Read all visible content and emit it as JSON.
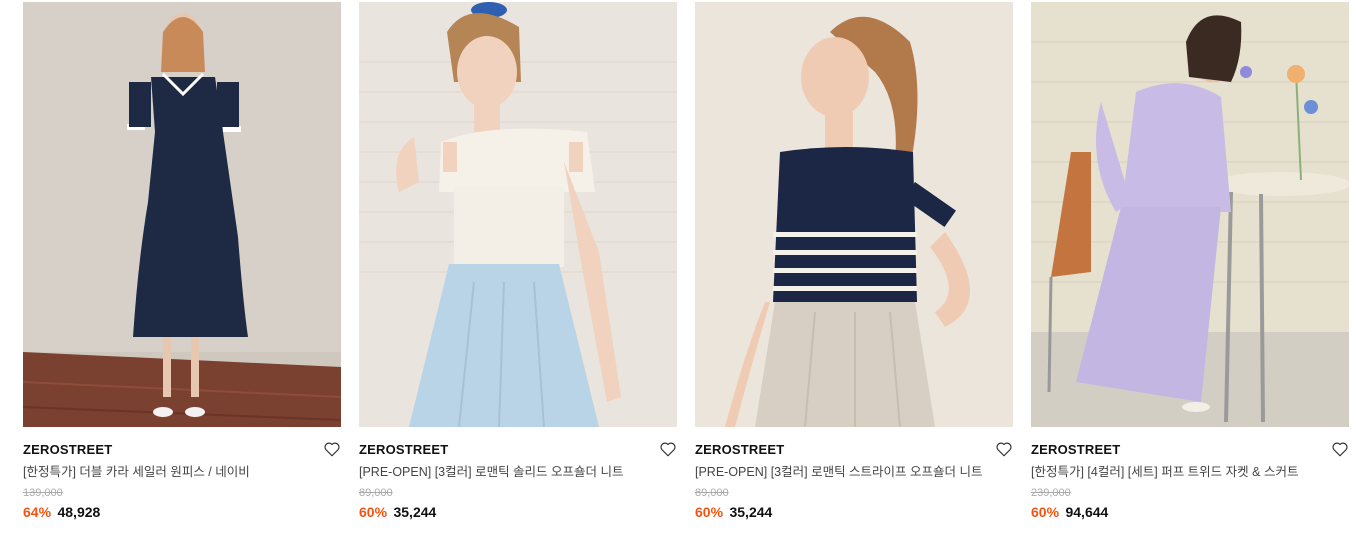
{
  "products": [
    {
      "brand": "ZEROSTREET",
      "title": "[한정특가] 더블 카라 세일러 원피스 / 네이비",
      "original_price": "139,000",
      "discount": "64%",
      "sale_price": "48,928"
    },
    {
      "brand": "ZEROSTREET",
      "title": "[PRE-OPEN] [3컬러] 로맨틱 솔리드 오프숄더 니트",
      "original_price": "89,000",
      "discount": "60%",
      "sale_price": "35,244"
    },
    {
      "brand": "ZEROSTREET",
      "title": "[PRE-OPEN] [3컬러] 로맨틱 스트라이프 오프숄더 니트",
      "original_price": "89,000",
      "discount": "60%",
      "sale_price": "35,244"
    },
    {
      "brand": "ZEROSTREET",
      "title": "[한정특가] [4컬러] [세트] 퍼프 트위드 자켓 & 스커트",
      "original_price": "239,000",
      "discount": "60%",
      "sale_price": "94,644"
    }
  ],
  "icons": {
    "wishlist": "heart-outline-icon"
  },
  "colors": {
    "discount": "#f25511",
    "brand_text": "#111111",
    "strike": "#aaaaaa"
  }
}
